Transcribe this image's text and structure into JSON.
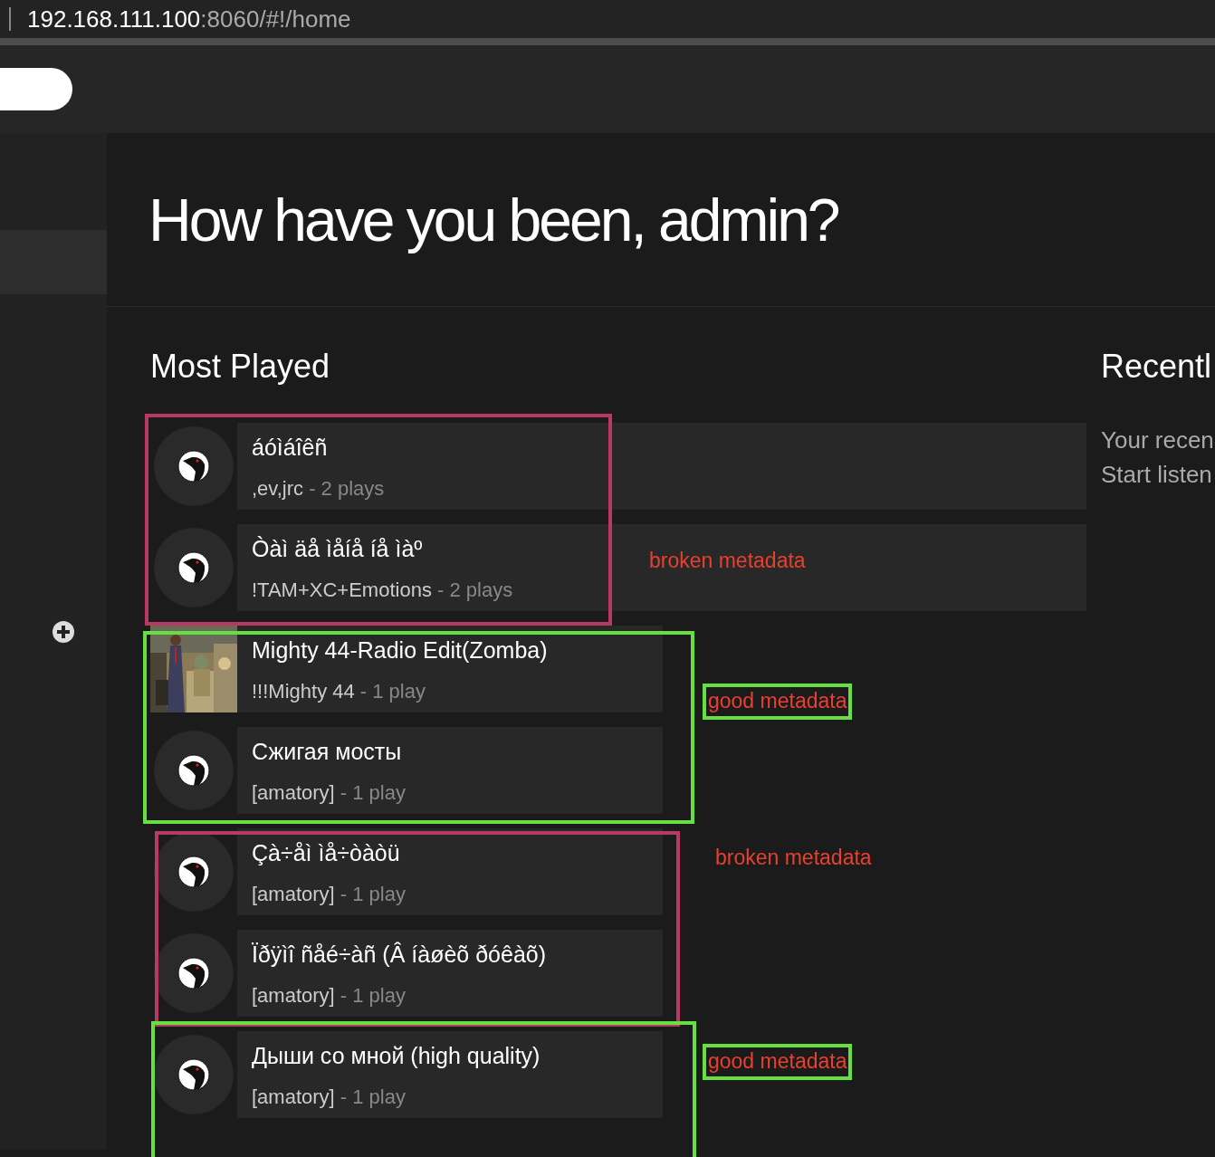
{
  "address_bar": {
    "host": "192.168.111.100",
    "path": ":8060/#!/home"
  },
  "greeting": "How have you been, admin?",
  "most_played": {
    "title": "Most Played",
    "songs": [
      {
        "kind": "avatar",
        "title": "áóìáîêñ",
        "artist": ",ev,jrc",
        "plays": "- 2 plays"
      },
      {
        "kind": "avatar",
        "title": "Òàì äå ìåíå íå ìàº",
        "artist": "!TAM+XC+Emotions",
        "plays": "- 2 plays"
      },
      {
        "kind": "cover",
        "title": "Mighty 44-Radio Edit(Zomba)",
        "artist": "!!!Mighty 44",
        "plays": "- 1 play"
      },
      {
        "kind": "avatar",
        "title": "Сжигая мосты",
        "artist": "[amatory]",
        "plays": "- 1 play"
      },
      {
        "kind": "avatar",
        "title": "Çà÷åì ìå÷òàòü",
        "artist": "[amatory]",
        "plays": "- 1 play"
      },
      {
        "kind": "avatar",
        "title": "Ïðÿìî ñåé÷àñ (Â íàøèõ ðóêàõ)",
        "artist": "[amatory]",
        "plays": "- 1 play"
      },
      {
        "kind": "avatar",
        "title": "Дыши со мной (high quality)",
        "artist": "[amatory]",
        "plays": "- 1 play"
      }
    ]
  },
  "recently": {
    "title": "Recentl",
    "lines": [
      "Your recen",
      "Start listen"
    ]
  },
  "annotations": [
    {
      "kind": "box",
      "color": "#b83a63"
    },
    {
      "kind": "label",
      "text": "broken metadata",
      "boxed": false
    },
    {
      "kind": "box",
      "color": "#66e040"
    },
    {
      "kind": "label",
      "text": "good metadata",
      "boxed": true
    },
    {
      "kind": "box",
      "color": "#b83a63"
    },
    {
      "kind": "label",
      "text": "broken metadata",
      "boxed": false
    },
    {
      "kind": "box",
      "color": "#66e040"
    },
    {
      "kind": "label",
      "text": "good metadata",
      "boxed": true
    }
  ]
}
